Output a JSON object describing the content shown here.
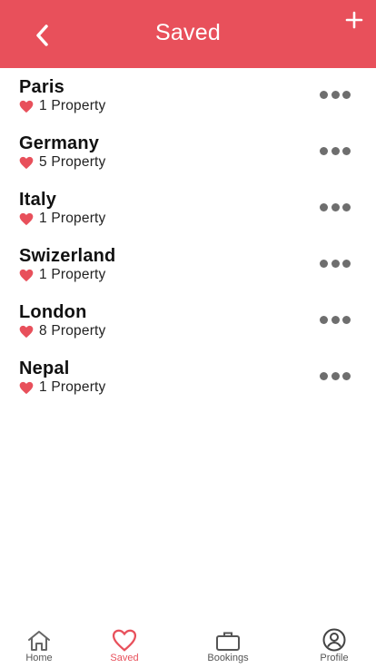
{
  "header": {
    "title": "Saved",
    "bg_color": "#e8505b",
    "back_icon": "chevron-left-icon",
    "add_icon": "plus-icon"
  },
  "items": [
    {
      "name": "Paris",
      "count": "1 Property"
    },
    {
      "name": "Germany",
      "count": "5 Property"
    },
    {
      "name": "Italy",
      "count": "1 Property"
    },
    {
      "name": "Swizerland",
      "count": "1 Property"
    },
    {
      "name": "London",
      "count": "8 Property"
    },
    {
      "name": "Nepal",
      "count": "1 Property"
    }
  ],
  "tabs": [
    {
      "label": "Home",
      "icon": "home-icon",
      "active": false
    },
    {
      "label": "Saved",
      "icon": "heart-outline-icon",
      "active": true
    },
    {
      "label": "Bookings",
      "icon": "briefcase-icon",
      "active": false
    },
    {
      "label": "Profile",
      "icon": "user-circle-icon",
      "active": false
    }
  ],
  "colors": {
    "accent": "#e8505b",
    "heart": "#e8505b",
    "more_dots": "#6e6e6e"
  }
}
